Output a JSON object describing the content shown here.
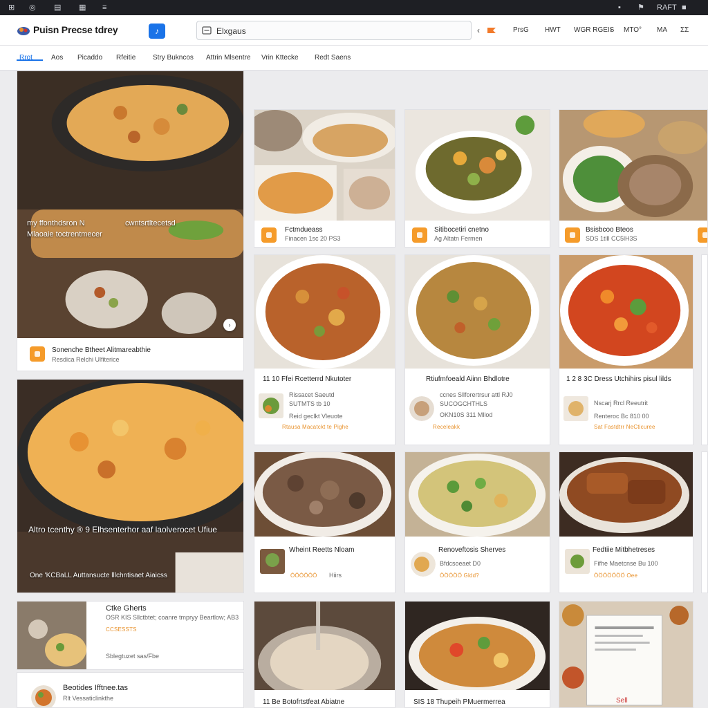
{
  "os_bar": {
    "left_icons": [
      "⊞",
      "◎",
      "▤",
      "▦",
      "≡"
    ],
    "right_icons": [
      "▪",
      "⚑",
      "■"
    ],
    "right_text": "RAFT"
  },
  "app": {
    "title": "Puisn Precse tdrey",
    "badge": "♪",
    "search_value": "Elxgaus",
    "header_right": [
      "‹",
      "PrsG",
      "HWT",
      "WGR RGEIS",
      "›",
      "MTO°",
      "MA",
      "ƩƩ"
    ],
    "accent": "#1a73e8",
    "orange": "#f59b2a"
  },
  "tabs": [
    "Rrot",
    "Aos",
    "Picaddo",
    "Rfeitie",
    "Stry Bukncos",
    "Attrin Mlsentre",
    "Vrin Kttecke",
    "Redt Saens"
  ],
  "feature_cards": [
    {
      "overlay_line1": "my ffonthdsron N",
      "overlay_line2": "Mlaoaie toctrentmecer",
      "overlay_right": "cwntsrtltecetsd",
      "title": "Sonenche Btheet Alitmareabthie",
      "sub": "Resdica Relchi Ulfiterice"
    },
    {
      "overlay_line1": "Altro tcenthy ® 9 Elhsenterhor aaf laolverocet Ufiue",
      "overlay_line2": "One 'KCBaLL Auttansucte lllchntisaet Aiaicss"
    }
  ],
  "side_cards": [
    {
      "title": "Ctke Gherts",
      "sub": "OSR KIS Sllctbtet; coanre tmpryy Beartlow; AB3",
      "stars": "CCSESSTS",
      "extra": "Sblegtuzet sas/Fbe"
    },
    {
      "title": "Beotides Ifftnee.tas",
      "sub": "Rlt Vessaticlinkthe"
    }
  ],
  "grid_row1": [
    {
      "title": "Fctmdueass",
      "sub": "Finacen 1sc 20 PS3"
    },
    {
      "title": "Sitibocetiri cnetno",
      "sub": "Ag Altatn Fermen"
    },
    {
      "title": "Bsisbcoo Bteos",
      "sub": "SDS 1tlll CC5lH3S"
    }
  ],
  "grid_row2": [
    {
      "title": "11 10 Ffei Rcetterrd Nkutoter",
      "l1": "Rissacet Saeutd",
      "l2": "SUTMTS tb 10",
      "l3": "Reid geclkt Vleuote",
      "stars": "Rtausa Macatckt te Pighe"
    },
    {
      "title": "Rtiufmfoeald Aiinn Bhdlotre",
      "l1": "ccnes Sllforertrsur attl RJ0",
      "l2": "SUCOGCHTHLS",
      "l3": "OKN10S 311 Mllod",
      "stars": "Receleakk"
    },
    {
      "title": "1 2 8 3C Dress Utchihirs pisul lilds",
      "l1": "Nscarj Rrcl Reeutrit",
      "l2": "Renteroc Bc 810 00",
      "l3": "",
      "stars": "Sat Fastdtrr NeCticuree"
    }
  ],
  "grid_row3": [
    {
      "title": "Wheint Reetts Nloam",
      "sub": "Hiirs",
      "stars": "ÖÖÖÖÖÖ"
    },
    {
      "title": "Renoveftosis Sherves",
      "sub": "Bfdcsoeaet D0",
      "stars": "ÖÖÖÖÖ Gldd?"
    },
    {
      "title": "Fedtiie Mitbhetreses",
      "sub": "Fifhe Maetcnse Bu 100",
      "stars": "ÖÖÖÖÖÖÖ Oee"
    }
  ],
  "grid_row4": [
    {
      "title": "11 Be Botofrtstfeat Abiatne"
    },
    {
      "title": "SIS 18 Thupeih PMuermerrea"
    },
    {
      "title": "Sell"
    }
  ]
}
